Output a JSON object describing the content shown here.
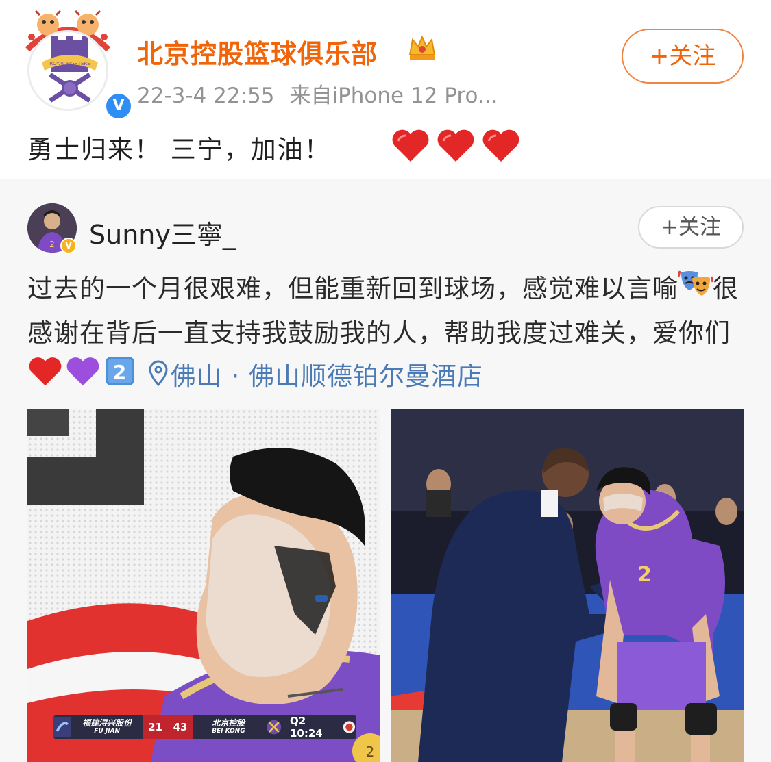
{
  "post": {
    "account_name": "北京控股篮球俱乐部",
    "logo_text": "ROYAL FIGHTERS",
    "verified_mark": "V",
    "timestamp": "22-3-4 22:55",
    "source": "来自iPhone 12 Pro...",
    "follow_label": "+关注",
    "text": "勇士归来！ 三宁，加油！",
    "hearts": [
      "❤",
      "❤",
      "❤"
    ]
  },
  "repost": {
    "author": "Sunny三寧_",
    "follow_label": "+关注",
    "text_part1": "过去的一个月很艰难，但能重新回到球场，感觉难以言喻",
    "text_part2": "很感谢在背后一直支持我鼓励我的人，帮助我度过难关，爱你们",
    "keycap": "2",
    "location": "佛山 · 佛山顺德铂尔曼酒店",
    "jersey_number": "2",
    "scorebug": {
      "home_team": "福建浔兴股份",
      "home_team_en": "FU JIAN",
      "home_score": "21",
      "away_score": "43",
      "away_team": "北京控股",
      "away_team_en": "BEI KONG",
      "quarter": "Q2",
      "clock": "10:24"
    }
  },
  "colors": {
    "accent_orange": "#f0650a",
    "link_blue": "#4a7bb6",
    "verified_blue": "#2f8ef5",
    "jersey_purple": "#7e4bc4"
  }
}
